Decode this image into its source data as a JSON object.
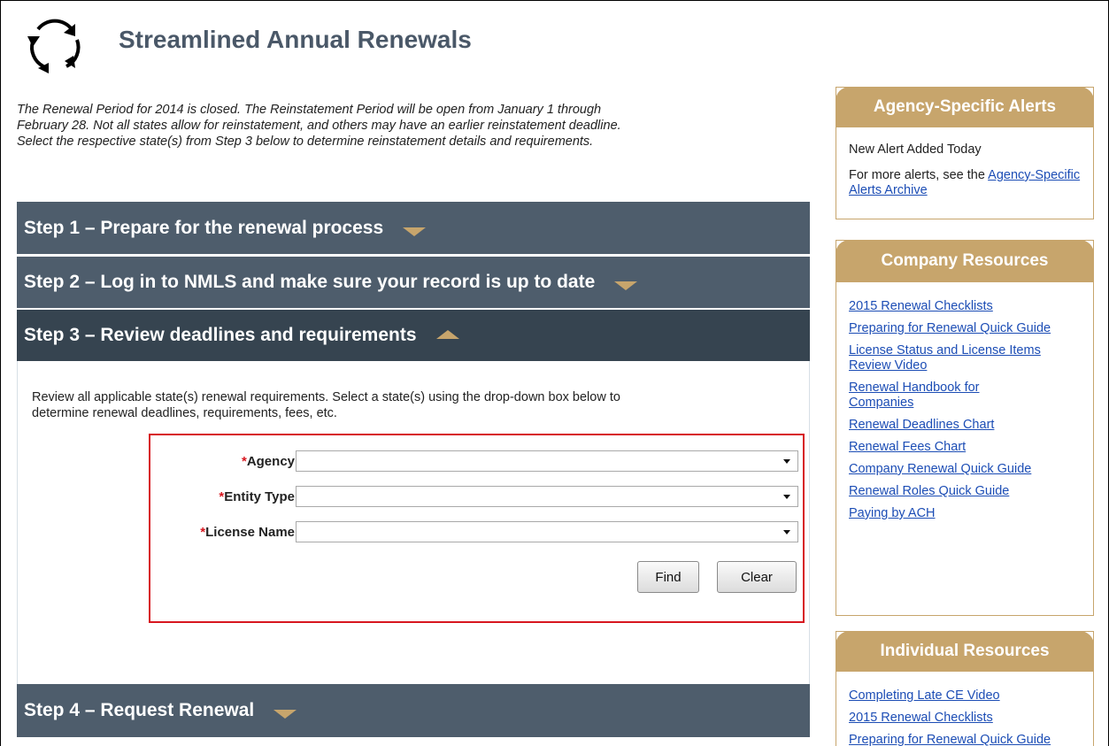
{
  "header": {
    "title": "Streamlined Annual Renewals",
    "logo_icon": "refresh-cycle-icon"
  },
  "intro": {
    "line1": "The Renewal Period for 2014 is closed. The Reinstatement Period will be open from January 1 through",
    "line2": "February 28. Not all states allow for reinstatement, and others may have an earlier reinstatement deadline.",
    "line3": "Select the respective state(s) from Step 3 below to determine reinstatement details and requirements."
  },
  "steps": [
    {
      "label": "Step 1 – Prepare for the renewal process",
      "state": "collapsed"
    },
    {
      "label": "Step 2 – Log in to NMLS and make sure your record is up to date",
      "state": "collapsed"
    },
    {
      "label": "Step 3 – Review deadlines and requirements",
      "state": "open"
    },
    {
      "label": "Step 4 – Request Renewal",
      "state": "collapsed"
    }
  ],
  "step3": {
    "desc_line1": "Review all applicable state(s) renewal requirements. Select a state(s) using the drop-down box below to",
    "desc_line2": "determine renewal deadlines, requirements, fees, etc.",
    "form": {
      "required_mark": "*",
      "agency_label": "Agency:",
      "agency_value": "",
      "entity_type_label": "Entity Type:",
      "entity_type_value": "",
      "license_name_label": "License Name:",
      "license_name_value": "",
      "find_label": "Find",
      "clear_label": "Clear"
    }
  },
  "sidebar": {
    "alerts": {
      "title": "Agency-Specific Alerts",
      "new_alert": "New Alert Added Today",
      "more_text": "For more alerts, see the ",
      "archive_link": "Agency-Specific Alerts Archive"
    },
    "company": {
      "title": "Company Resources",
      "links": [
        "2015 Renewal Checklists",
        "Preparing for Renewal Quick Guide",
        "License Status and License Items Review Video",
        "Renewal Handbook for Companies",
        "Renewal Deadlines Chart",
        "Renewal Fees Chart",
        "Company Renewal Quick Guide",
        "Renewal Roles Quick Guide",
        "Paying by ACH"
      ]
    },
    "individual": {
      "title": "Individual Resources",
      "links": [
        "Completing Late CE Video",
        "2015 Renewal Checklists",
        "Preparing for Renewal Quick Guide"
      ]
    }
  },
  "colors": {
    "title": "#4a5868",
    "step_bar": "#4e5d6c",
    "step_bar_open": "#364450",
    "accent_gold": "#c7a56c",
    "required": "#d7171f",
    "link": "#1c4db5"
  }
}
